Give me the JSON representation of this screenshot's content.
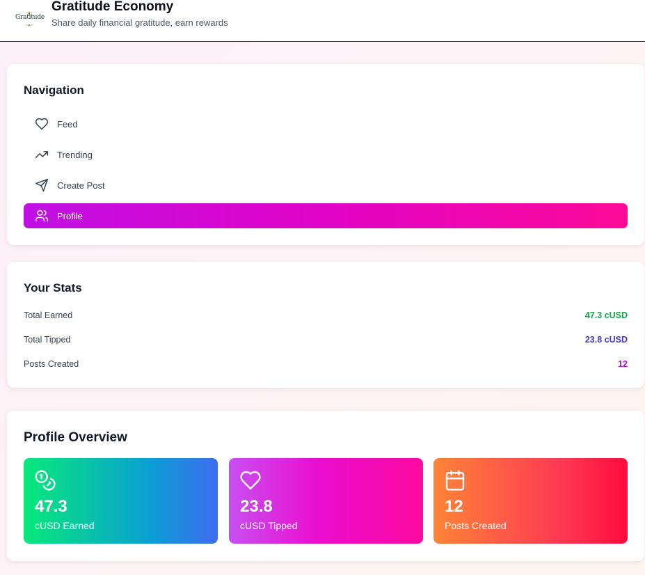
{
  "header": {
    "logo_text": "Gratitude",
    "title": "Gratitude Economy",
    "subtitle": "Share daily financial gratitude, earn rewards"
  },
  "navigation": {
    "title": "Navigation",
    "items": [
      {
        "label": "Feed",
        "icon": "heart-icon",
        "active": false
      },
      {
        "label": "Trending",
        "icon": "trending-up-icon",
        "active": false
      },
      {
        "label": "Create Post",
        "icon": "send-icon",
        "active": false
      },
      {
        "label": "Profile",
        "icon": "users-icon",
        "active": true
      }
    ],
    "active_gradient": [
      "#c010e4",
      "#fb0a97"
    ]
  },
  "stats": {
    "title": "Your Stats",
    "rows": [
      {
        "label": "Total Earned",
        "value": "47.3 cUSD",
        "color": "#16a34a"
      },
      {
        "label": "Total Tipped",
        "value": "23.8 cUSD",
        "color": "#4338ca"
      },
      {
        "label": "Posts Created",
        "value": "12",
        "color": "#b00ddb"
      }
    ]
  },
  "overview": {
    "title": "Profile Overview",
    "tiles": [
      {
        "value": "47.3",
        "label": "cUSD Earned",
        "icon": "coins-icon",
        "gradient": [
          "#08e97a",
          "#0a9fd3",
          "#3f6bf0"
        ]
      },
      {
        "value": "23.8",
        "label": "cUSD Tipped",
        "icon": "heart-icon",
        "gradient": [
          "#c84ff0",
          "#ea0ed0",
          "#fd0aa0"
        ]
      },
      {
        "value": "12",
        "label": "Posts Created",
        "icon": "calendar-icon",
        "gradient": [
          "#fe8437",
          "#fe3a52",
          "#ff0c3d"
        ]
      }
    ]
  }
}
